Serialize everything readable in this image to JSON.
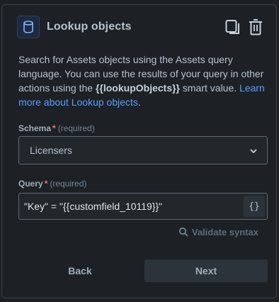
{
  "header": {
    "title": "Lookup objects",
    "icon": "database-icon",
    "actions": [
      "copy-icon",
      "trash-icon"
    ]
  },
  "description": {
    "part1": "Search for Assets objects using the Assets query language. You can use the results of your query in other actions using the ",
    "smart_value": "{{lookupObjects}}",
    "part2": " smart value. ",
    "link": "Learn more about Lookup objects",
    "end": "."
  },
  "schema": {
    "label": "Schema",
    "required_mark": "*",
    "required_text": "(required)",
    "value": "Licensers"
  },
  "query": {
    "label": "Query",
    "required_mark": "*",
    "required_text": "(required)",
    "value": "\"Key\" = \"{{customfield_10119}}\"",
    "braces_label": "{}"
  },
  "validate": {
    "label": "Validate syntax"
  },
  "footer": {
    "back_label": "Back",
    "next_label": "Next"
  },
  "colors": {
    "background": "#1d2125",
    "text": "#b6c2cf",
    "link": "#579dff",
    "required": "#f87168",
    "button": "#2c333a"
  }
}
